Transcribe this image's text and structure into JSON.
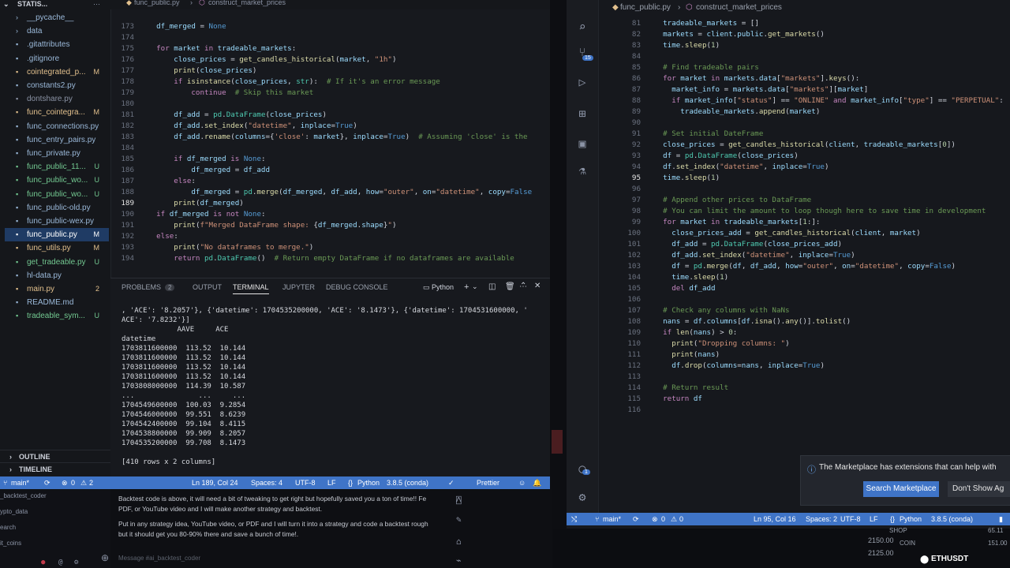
{
  "left": {
    "explorer_title": "STATIS...",
    "files": [
      {
        "name": "__pycache__",
        "status": "",
        "color": "#9ab8d8",
        "icon": "folder-icon"
      },
      {
        "name": "data",
        "status": "",
        "color": "#9ab8d8",
        "icon": "folder-icon"
      },
      {
        "name": ".gitattributes",
        "status": "",
        "color": "#9ab8d8",
        "icon": "file-icon"
      },
      {
        "name": ".gitignore",
        "status": "",
        "color": "#9ab8d8",
        "icon": "file-icon"
      },
      {
        "name": "cointegrated_p...",
        "status": "M",
        "color": "#e2c08d",
        "icon": "file-icon"
      },
      {
        "name": "constants2.py",
        "status": "",
        "color": "#9ab8d8",
        "icon": "file-icon"
      },
      {
        "name": "dontshare.py",
        "status": "",
        "color": "#8b93a5",
        "icon": "file-icon"
      },
      {
        "name": "func_cointegra...",
        "status": "M",
        "color": "#e2c08d",
        "icon": "file-icon"
      },
      {
        "name": "func_connections.py",
        "status": "",
        "color": "#9ab8d8",
        "icon": "file-icon"
      },
      {
        "name": "func_entry_pairs.py",
        "status": "",
        "color": "#9ab8d8",
        "icon": "file-icon"
      },
      {
        "name": "func_private.py",
        "status": "",
        "color": "#9ab8d8",
        "icon": "file-icon"
      },
      {
        "name": "func_public_11...",
        "status": "U",
        "color": "#73c991",
        "icon": "file-icon"
      },
      {
        "name": "func_public_wo...",
        "status": "U",
        "color": "#73c991",
        "icon": "file-icon"
      },
      {
        "name": "func_public_wo...",
        "status": "U",
        "color": "#73c991",
        "icon": "file-icon"
      },
      {
        "name": "func_public-old.py",
        "status": "",
        "color": "#9ab8d8",
        "icon": "file-icon"
      },
      {
        "name": "func_public-wex.py",
        "status": "",
        "color": "#9ab8d8",
        "icon": "file-icon"
      },
      {
        "name": "func_public.py",
        "status": "M",
        "color": "#ffffff",
        "icon": "file-icon",
        "active": true
      },
      {
        "name": "func_utils.py",
        "status": "M",
        "color": "#e2c08d",
        "icon": "file-icon"
      },
      {
        "name": "get_tradeable.py",
        "status": "U",
        "color": "#73c991",
        "icon": "file-icon"
      },
      {
        "name": "hl-data.py",
        "status": "",
        "color": "#9ab8d8",
        "icon": "file-icon"
      },
      {
        "name": "main.py",
        "status": "2",
        "color": "#e2c08d",
        "icon": "file-icon"
      },
      {
        "name": "README.md",
        "status": "",
        "color": "#9ab8d8",
        "icon": "file-icon"
      },
      {
        "name": "tradeable_sym...",
        "status": "U",
        "color": "#73c991",
        "icon": "file-icon"
      }
    ],
    "outline_label": "OUTLINE",
    "timeline_label": "TIMELINE",
    "breadcrumb_file": "func_public.py",
    "breadcrumb_fn": "construct_market_prices",
    "code_lines": [
      {
        "n": "173",
        "html": "    <span class='var'>df_merged</span> = <span class='con'>None</span>"
      },
      {
        "n": "174",
        "html": ""
      },
      {
        "n": "175",
        "html": "    <span class='kw'>for</span> <span class='var'>market</span> <span class='kw'>in</span> <span class='var'>tradeable_markets</span>:"
      },
      {
        "n": "176",
        "html": "        <span class='var'>close_prices</span> = <span class='fn'>get_candles_historical</span>(<span class='var'>market</span>, <span class='str'>\"1h\"</span>)"
      },
      {
        "n": "177",
        "html": "        <span class='fn'>print</span>(<span class='var'>close_prices</span>)"
      },
      {
        "n": "178",
        "html": "        <span class='kw'>if</span> <span class='fn'>isinstance</span>(<span class='var'>close_prices</span>, <span class='cls'>str</span>):  <span class='com'># If it's an error message</span>"
      },
      {
        "n": "179",
        "html": "            <span class='kw'>continue</span>  <span class='com'># Skip this market</span>"
      },
      {
        "n": "180",
        "html": ""
      },
      {
        "n": "181",
        "html": "        <span class='var'>df_add</span> = <span class='cls'>pd</span>.<span class='cls'>DataFrame</span>(<span class='var'>close_prices</span>)"
      },
      {
        "n": "182",
        "html": "        <span class='var'>df_add</span>.<span class='fn'>set_index</span>(<span class='str'>\"datetime\"</span>, <span class='var'>inplace</span>=<span class='con'>True</span>)"
      },
      {
        "n": "183",
        "html": "        <span class='var'>df_add</span>.<span class='fn'>rename</span>(<span class='var'>columns</span>={<span class='str'>'close'</span>: <span class='var'>market</span>}, <span class='var'>inplace</span>=<span class='con'>True</span>)  <span class='com'># Assuming 'close' is the</span>"
      },
      {
        "n": "184",
        "html": ""
      },
      {
        "n": "185",
        "html": "        <span class='kw'>if</span> <span class='var'>df_merged</span> <span class='kw'>is</span> <span class='con'>None</span>:"
      },
      {
        "n": "186",
        "html": "            <span class='var'>df_merged</span> = <span class='var'>df_add</span>"
      },
      {
        "n": "187",
        "html": "        <span class='kw'>else</span>:"
      },
      {
        "n": "188",
        "html": "            <span class='var'>df_merged</span> = <span class='cls'>pd</span>.<span class='fn'>merge</span>(<span class='var'>df_merged</span>, <span class='var'>df_add</span>, <span class='var'>how</span>=<span class='str'>\"outer\"</span>, <span class='var'>on</span>=<span class='str'>\"datetime\"</span>, <span class='var'>copy</span>=<span class='con'>False</span>"
      },
      {
        "n": "189",
        "html": "        <span class='fn'>print</span>(<span class='var'>df_merged</span>)"
      },
      {
        "n": "190",
        "html": "    <span class='kw'>if</span> <span class='var'>df_merged</span> <span class='kw'>is not</span> <span class='con'>None</span>:"
      },
      {
        "n": "191",
        "html": "        <span class='fn'>print</span>(<span class='str'>f\"Merged DataFrame shape: </span>{<span class='var'>df_merged</span>.<span class='var'>shape</span>}<span class='str'>\"</span>)"
      },
      {
        "n": "192",
        "html": "    <span class='kw'>else</span>:"
      },
      {
        "n": "193",
        "html": "        <span class='fn'>print</span>(<span class='str'>\"No dataframes to merge.\"</span>)"
      },
      {
        "n": "194",
        "html": "        <span class='kw'>return</span> <span class='cls'>pd</span>.<span class='cls'>DataFrame</span>()  <span class='com'># Return empty DataFrame if no dataframes are available</span>"
      }
    ],
    "panel_tabs": [
      {
        "label": "PROBLEMS",
        "badge": "2",
        "active": false
      },
      {
        "label": "OUTPUT",
        "active": false
      },
      {
        "label": "TERMINAL",
        "active": true
      },
      {
        "label": "JUPYTER",
        "active": false
      },
      {
        "label": "DEBUG CONSOLE",
        "active": false
      }
    ],
    "terminal_shell": "Python",
    "terminal_lines": [
      ", 'ACE': '8.2057'}, {'datetime': 1704535200000, 'ACE': '8.1473'}, {'datetime': 1704531600000, '",
      "ACE': '7.8232'}]",
      "             AAVE     ACE",
      "datetime",
      "1703811600000  113.52  10.144",
      "1703811600000  113.52  10.144",
      "1703811600000  113.52  10.144",
      "1703811600000  113.52  10.144",
      "1703808000000  114.39  10.587",
      "...               ...     ...",
      "1704549600000  100.03  9.2854",
      "1704546000000  99.551  8.6239",
      "1704542400000  99.104  8.4115",
      "1704538800000  99.909  8.2057",
      "1704535200000  99.708  8.1473",
      "",
      "[410 rows x 2 columns]"
    ],
    "status": {
      "branch": "main*",
      "errors": "0",
      "warnings": "2",
      "position": "Ln 189, Col 24",
      "spaces": "Spaces: 4",
      "encoding": "UTF-8",
      "eol": "LF",
      "language": "Python",
      "interpreter": "3.8.5 (conda)",
      "formatter": "Prettier"
    }
  },
  "right": {
    "breadcrumb_file": "func_public.py",
    "breadcrumb_fn": "construct_market_prices",
    "badge": "15",
    "account_badge": "1",
    "code_lines": [
      {
        "n": "81",
        "html": "    <span class='var'>tradeable_markets</span> = []"
      },
      {
        "n": "82",
        "html": "    <span class='var'>markets</span> = <span class='var'>client</span>.<span class='var'>public</span>.<span class='fn'>get_markets</span>()"
      },
      {
        "n": "83",
        "html": "    <span class='var'>time</span>.<span class='fn'>sleep</span>(<span class='num'>1</span>)"
      },
      {
        "n": "84",
        "html": ""
      },
      {
        "n": "85",
        "html": "    <span class='com'># Find tradeable pairs</span>"
      },
      {
        "n": "86",
        "html": "    <span class='kw'>for</span> <span class='var'>market</span> <span class='kw'>in</span> <span class='var'>markets</span>.<span class='var'>data</span>[<span class='str'>\"markets\"</span>].<span class='fn'>keys</span>():"
      },
      {
        "n": "87",
        "html": "      <span class='var'>market_info</span> = <span class='var'>markets</span>.<span class='var'>data</span>[<span class='str'>\"markets\"</span>][<span class='var'>market</span>]"
      },
      {
        "n": "88",
        "html": "      <span class='kw'>if</span> <span class='var'>market_info</span>[<span class='str'>\"status\"</span>] == <span class='str'>\"ONLINE\"</span> <span class='kw'>and</span> <span class='var'>market_info</span>[<span class='str'>\"type\"</span>] == <span class='str'>\"PERPETUAL\"</span>:"
      },
      {
        "n": "89",
        "html": "        <span class='var'>tradeable_markets</span>.<span class='fn'>append</span>(<span class='var'>market</span>)"
      },
      {
        "n": "90",
        "html": ""
      },
      {
        "n": "91",
        "html": "    <span class='com'># Set initial DateFrame</span>"
      },
      {
        "n": "92",
        "html": "    <span class='var'>close_prices</span> = <span class='fn'>get_candles_historical</span>(<span class='var'>client</span>, <span class='var'>tradeable_markets</span>[<span class='num'>0</span>])"
      },
      {
        "n": "93",
        "html": "    <span class='var'>df</span> = <span class='cls'>pd</span>.<span class='cls'>DataFrame</span>(<span class='var'>close_prices</span>)"
      },
      {
        "n": "94",
        "html": "    <span class='var'>df</span>.<span class='fn'>set_index</span>(<span class='str'>\"datetime\"</span>, <span class='var'>inplace</span>=<span class='con'>True</span>)"
      },
      {
        "n": "95",
        "html": "    <span class='var'>time</span>.<span class='fn'>sleep</span>(<span class='num'>1</span>)"
      },
      {
        "n": "96",
        "html": ""
      },
      {
        "n": "97",
        "html": "    <span class='com'># Append other prices to DataFrame</span>"
      },
      {
        "n": "98",
        "html": "    <span class='com'># You can limit the amount to loop though here to save time in development</span>"
      },
      {
        "n": "99",
        "html": "    <span class='kw'>for</span> <span class='var'>market</span> <span class='kw'>in</span> <span class='var'>tradeable_markets</span>[<span class='num'>1</span>:]:"
      },
      {
        "n": "100",
        "html": "      <span class='var'>close_prices_add</span> = <span class='fn'>get_candles_historical</span>(<span class='var'>client</span>, <span class='var'>market</span>)"
      },
      {
        "n": "101",
        "html": "      <span class='var'>df_add</span> = <span class='cls'>pd</span>.<span class='cls'>DataFrame</span>(<span class='var'>close_prices_add</span>)"
      },
      {
        "n": "102",
        "html": "      <span class='var'>df_add</span>.<span class='fn'>set_index</span>(<span class='str'>\"datetime\"</span>, <span class='var'>inplace</span>=<span class='con'>True</span>)"
      },
      {
        "n": "103",
        "html": "      <span class='var'>df</span> = <span class='cls'>pd</span>.<span class='fn'>merge</span>(<span class='var'>df</span>, <span class='var'>df_add</span>, <span class='var'>how</span>=<span class='str'>\"outer\"</span>, <span class='var'>on</span>=<span class='str'>\"datetime\"</span>, <span class='var'>copy</span>=<span class='con'>False</span>)"
      },
      {
        "n": "104",
        "html": "      <span class='var'>time</span>.<span class='fn'>sleep</span>(<span class='num'>1</span>)"
      },
      {
        "n": "105",
        "html": "      <span class='kw'>del</span> <span class='var'>df_add</span>"
      },
      {
        "n": "106",
        "html": ""
      },
      {
        "n": "107",
        "html": "    <span class='com'># Check any columns with NaNs</span>"
      },
      {
        "n": "108",
        "html": "    <span class='var'>nans</span> = <span class='var'>df</span>.<span class='var'>columns</span>[<span class='var'>df</span>.<span class='fn'>isna</span>().<span class='fn'>any</span>()].<span class='fn'>tolist</span>()"
      },
      {
        "n": "109",
        "html": "    <span class='kw'>if</span> <span class='fn'>len</span>(<span class='var'>nans</span>) > <span class='num'>0</span>:"
      },
      {
        "n": "110",
        "html": "      <span class='fn'>print</span>(<span class='str'>\"Dropping columns: \"</span>)"
      },
      {
        "n": "111",
        "html": "      <span class='fn'>print</span>(<span class='var'>nans</span>)"
      },
      {
        "n": "112",
        "html": "      <span class='var'>df</span>.<span class='fn'>drop</span>(<span class='var'>columns</span>=<span class='var'>nans</span>, <span class='var'>inplace</span>=<span class='con'>True</span>)"
      },
      {
        "n": "113",
        "html": ""
      },
      {
        "n": "114",
        "html": "    <span class='com'># Return result</span>"
      },
      {
        "n": "115",
        "html": "    <span class='kw'>return</span> <span class='var'>df</span>"
      },
      {
        "n": "116",
        "html": ""
      }
    ],
    "notification_text": "The Marketplace has extensions that can help with",
    "search_marketplace": "Search Marketplace",
    "dont_show": "Don't Show Ag",
    "status": {
      "branch": "main*",
      "errors": "0",
      "warnings": "0",
      "position": "Ln 95, Col 16",
      "spaces": "Spaces: 2",
      "encoding": "UTF-8",
      "eol": "LF",
      "language": "Python",
      "interpreter": "3.8.5 (conda)"
    }
  },
  "chat": {
    "side_items": [
      "_backtest_coder",
      "ypto_data",
      "earch",
      "it_coins"
    ],
    "messages": [
      "Backtest code is above, it will need a bit of tweaking to get right but hopefully saved you a ton of time!! Fe",
      "PDF, or YouTube video and I will make another strategy and backtest.",
      "Put in any strategy idea, YouTube video, or PDF and I will turn it into a strategy and code a backtest rough",
      "but it should get you 80-90% there and save a bunch of time!."
    ],
    "input_placeholder": "Message #ai_backtest_coder"
  },
  "ticker": {
    "label1": "SHOP",
    "label2": "COIN",
    "price1": "2150.00",
    "price2": "2125.00",
    "symbol": "ETHUSDT",
    "side_price1": "151.00",
    "side_price2": "65.11"
  }
}
